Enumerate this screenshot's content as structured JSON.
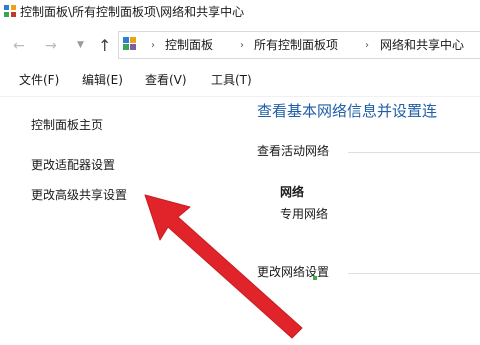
{
  "window": {
    "title": "控制面板\\所有控制面板项\\网络和共享中心"
  },
  "nav": {
    "back_icon": "arrow-left-icon",
    "forward_icon": "arrow-right-icon",
    "up_icon": "arrow-up-icon",
    "address": {
      "icon": "control-panel-icon",
      "crumbs": [
        "控制面板",
        "所有控制面板项",
        "网络和共享中心"
      ]
    }
  },
  "menu": {
    "items": [
      "文件(F)",
      "编辑(E)",
      "查看(V)",
      "工具(T)"
    ]
  },
  "sidebar": {
    "items": [
      "控制面板主页",
      "更改适配器设置",
      "更改高级共享设置"
    ]
  },
  "main": {
    "heading": "查看基本网络信息并设置连",
    "active_networks_label": "查看活动网络",
    "network": {
      "name": "网络",
      "type": "专用网络"
    },
    "change_settings_label": "更改网络设置"
  },
  "annotation": {
    "arrow_color": "#e0242a",
    "arrow_icon": "red-pointer-arrow"
  },
  "colors": {
    "heading_blue": "#1f5ea8"
  }
}
